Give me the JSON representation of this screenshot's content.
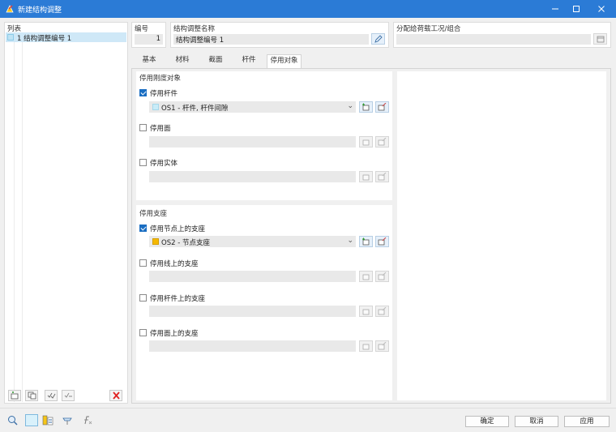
{
  "window": {
    "title": "新建结构调整"
  },
  "list": {
    "header": "列表",
    "items": [
      {
        "label": "1  结构调整编号 1",
        "color": "#bfe3f4"
      }
    ]
  },
  "header": {
    "number_label": "编号",
    "number_value": "1",
    "name_label": "结构调整名称",
    "name_value": "结构调整编号 1",
    "assign_label": "分配给荷载工况/组合",
    "assign_value": ""
  },
  "tabs": [
    {
      "label": "基本",
      "active": false
    },
    {
      "label": "材料",
      "active": false
    },
    {
      "label": "截面",
      "active": false
    },
    {
      "label": "杆件",
      "active": false
    },
    {
      "label": "停用对象",
      "active": true
    }
  ],
  "deactivate_objects": {
    "title": "停用刚度对象",
    "items": [
      {
        "label": "停用杆件",
        "checked": true,
        "selection": "OS1 - 杆件, 杆件间隙",
        "swatch_color": "#c9ecf8"
      },
      {
        "label": "停用面",
        "checked": false,
        "selection": ""
      },
      {
        "label": "停用实体",
        "checked": false,
        "selection": ""
      }
    ]
  },
  "deactivate_supports": {
    "title": "停用支座",
    "items": [
      {
        "label": "停用节点上的支座",
        "checked": true,
        "selection": "OS2 - 节点支座",
        "swatch_color": "#f5b800"
      },
      {
        "label": "停用线上的支座",
        "checked": false,
        "selection": ""
      },
      {
        "label": "停用杆件上的支座",
        "checked": false,
        "selection": ""
      },
      {
        "label": "停用面上的支座",
        "checked": false,
        "selection": ""
      }
    ]
  },
  "footer": {
    "ok": "确定",
    "cancel": "取消",
    "apply": "应用"
  }
}
